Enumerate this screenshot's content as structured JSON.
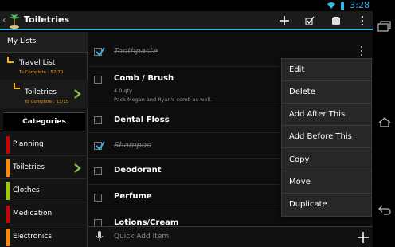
{
  "status": {
    "time": "3:28"
  },
  "actionbar": {
    "title": "Toiletries",
    "buttons": [
      "add-icon",
      "checklist-icon",
      "storage-icon",
      "overflow-icon"
    ]
  },
  "sidebar": {
    "header": "My Lists",
    "lists": [
      {
        "name": "Travel List",
        "progress": "To Complete : 52/70"
      },
      {
        "name": "Toiletries",
        "progress": "To Complete : 13/15"
      }
    ],
    "categories_header": "Categories",
    "categories": [
      {
        "label": "Planning",
        "color": "#cc0000"
      },
      {
        "label": "Toiletries",
        "color": "#ff8800"
      },
      {
        "label": "Clothes",
        "color": "#99cc00"
      },
      {
        "label": "Medication",
        "color": "#cc0000"
      },
      {
        "label": "Electronics",
        "color": "#ff8800"
      }
    ]
  },
  "items": [
    {
      "name": "Toothpaste",
      "checked": true
    },
    {
      "name": "Comb / Brush",
      "checked": false,
      "qty": "4.0 qty",
      "note": "Pack Megan and Ryan's comb as well."
    },
    {
      "name": "Dental Floss",
      "checked": false
    },
    {
      "name": "Shampoo",
      "checked": true
    },
    {
      "name": "Deodorant",
      "checked": false
    },
    {
      "name": "Perfume",
      "checked": false
    },
    {
      "name": "Lotions/Cream",
      "checked": false
    }
  ],
  "popup_menu": [
    "Edit",
    "Delete",
    "Add After This",
    "Add Before This",
    "Copy",
    "Move",
    "Duplicate"
  ],
  "quickbar": {
    "placeholder": "Quick Add Item"
  },
  "colors": {
    "accent": "#33b5e5",
    "bracket": "#f3b400",
    "chevron": "#8bc34a"
  }
}
